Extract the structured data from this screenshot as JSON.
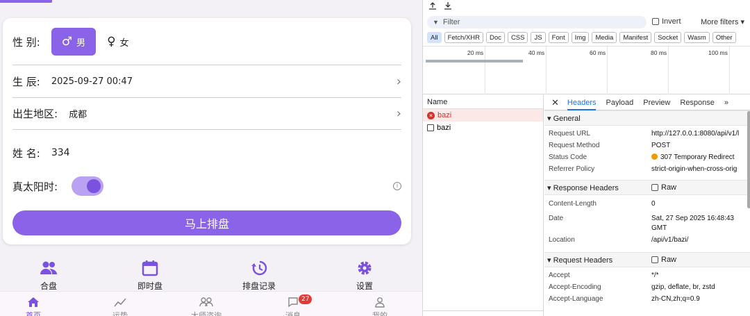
{
  "app": {
    "form": {
      "gender": {
        "label": "性 别:",
        "male": "男",
        "female": "女",
        "male_symbol": "♂",
        "female_symbol": "♀"
      },
      "birth": {
        "label": "生 辰:",
        "value": "2025-09-27 00:47"
      },
      "region": {
        "label": "出生地区:",
        "value": "成都"
      },
      "name": {
        "label": "姓 名:",
        "value": "334"
      },
      "solar": {
        "label": "真太阳时:",
        "enabled": true
      },
      "submit_label": "马上排盘"
    },
    "quick_actions": [
      {
        "label": "合盘",
        "icon": "people-icon"
      },
      {
        "label": "即时盘",
        "icon": "calendar-icon"
      },
      {
        "label": "排盘记录",
        "icon": "history-icon"
      },
      {
        "label": "设置",
        "icon": "gear-icon"
      }
    ],
    "tabbar": [
      {
        "label": "首页",
        "icon": "home-icon",
        "active": true
      },
      {
        "label": "运势",
        "icon": "trend-icon"
      },
      {
        "label": "大师咨询",
        "icon": "group-icon"
      },
      {
        "label": "消息",
        "icon": "message-icon",
        "badge": "27"
      },
      {
        "label": "我的",
        "icon": "user-icon"
      }
    ],
    "accent_color": "#8a63e8"
  },
  "devtools": {
    "filter_placeholder": "Filter",
    "invert_label": "Invert",
    "more_filters": "More filters ▾",
    "types": [
      "All",
      "Fetch/XHR",
      "Doc",
      "CSS",
      "JS",
      "Font",
      "Img",
      "Media",
      "Manifest",
      "Socket",
      "Wasm",
      "Other"
    ],
    "timeline_ticks": [
      "20 ms",
      "40 ms",
      "60 ms",
      "80 ms",
      "100 ms"
    ],
    "name_header": "Name",
    "requests": [
      {
        "name": "bazi",
        "error": true
      },
      {
        "name": "bazi",
        "error": false
      }
    ],
    "tabs": [
      "Headers",
      "Payload",
      "Preview",
      "Response",
      "»"
    ],
    "general": {
      "title": "▾ General",
      "rows": [
        {
          "k": "Request URL",
          "v": "http://127.0.0.1:8080/api/v1/l"
        },
        {
          "k": "Request Method",
          "v": "POST"
        },
        {
          "k": "Status Code",
          "v": "307 Temporary Redirect"
        },
        {
          "k": "Referrer Policy",
          "v": "strict-origin-when-cross-orig"
        }
      ]
    },
    "response_headers": {
      "title": "▾ Response Headers",
      "raw": "Raw",
      "rows": [
        {
          "k": "Content-Length",
          "v": "0"
        },
        {
          "k": "Date",
          "v": "Sat, 27 Sep 2025 16:48:43"
        },
        {
          "k": "",
          "v": "GMT"
        },
        {
          "k": "Location",
          "v": "/api/v1/bazi/"
        }
      ]
    },
    "request_headers": {
      "title": "▾ Request Headers",
      "raw": "Raw",
      "rows": [
        {
          "k": "Accept",
          "v": "*/*"
        },
        {
          "k": "Accept-Encoding",
          "v": "gzip, deflate, br, zstd"
        },
        {
          "k": "Accept-Language",
          "v": "zh-CN,zh;q=0.9"
        }
      ]
    }
  }
}
